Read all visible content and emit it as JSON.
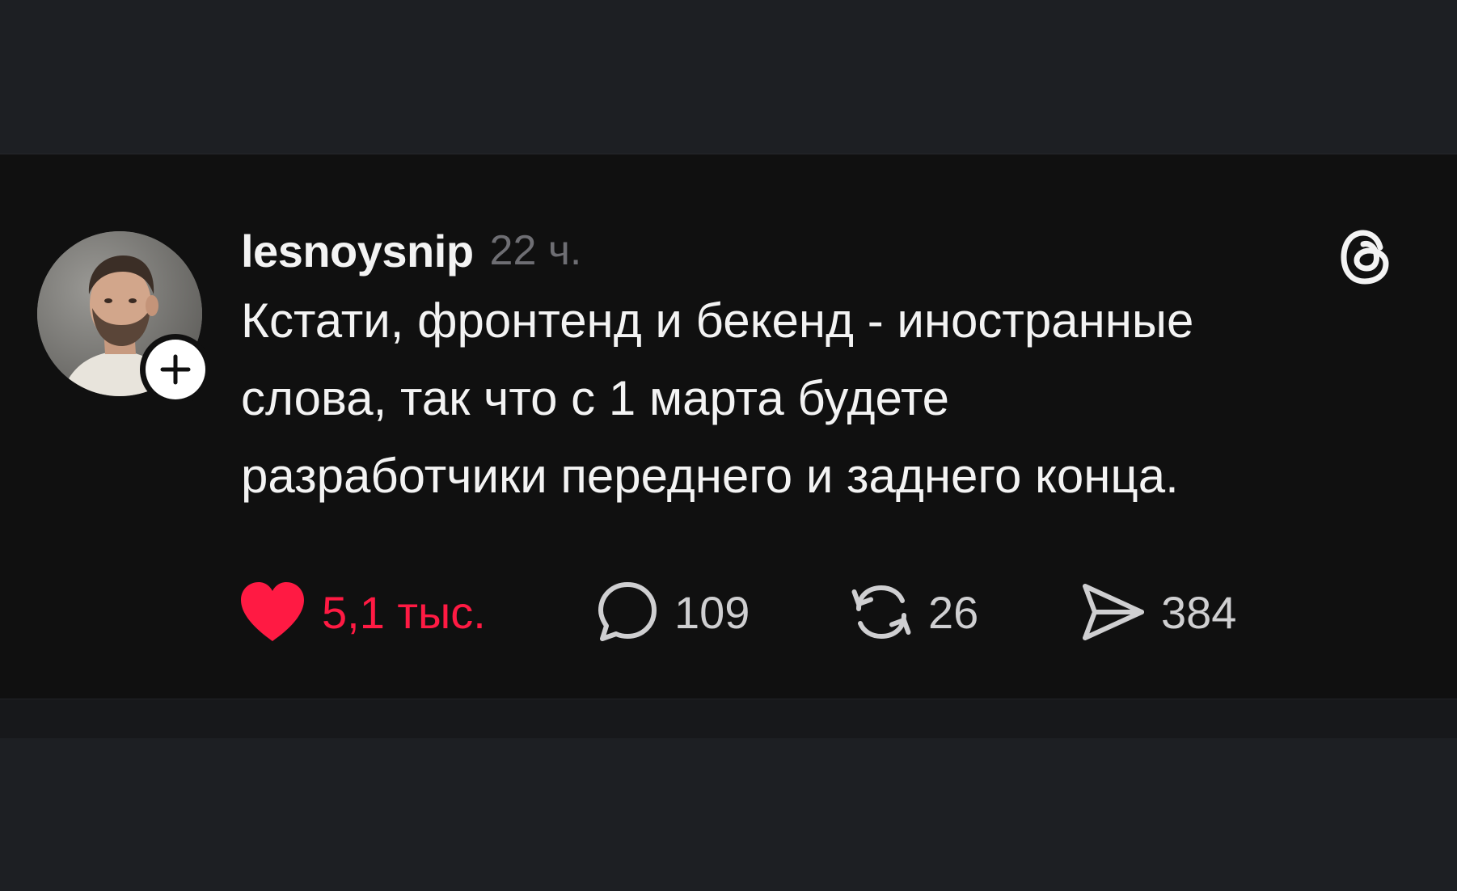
{
  "post": {
    "username": "lesnoysnip",
    "time": "22 ч.",
    "text_lines": [
      "Кстати, фронтенд и бекенд - иностранные",
      "слова, так что с 1 марта будете",
      "разработчики переднего и заднего конца."
    ]
  },
  "actions": {
    "likes": "5,1 тыс.",
    "replies": "109",
    "reposts": "26",
    "shares": "384"
  },
  "icons": {
    "avatar": "user-avatar",
    "follow": "plus-icon",
    "logo": "threads-logo-icon",
    "like": "heart-filled-icon",
    "reply": "speech-bubble-icon",
    "repost": "repost-arrows-icon",
    "share": "paper-plane-icon"
  },
  "colors": {
    "page_background": "#1d1f23",
    "card_background": "#101010",
    "text_primary": "#f3f3f3",
    "text_secondary": "#6e6e73",
    "like_active": "#ff1a43"
  }
}
